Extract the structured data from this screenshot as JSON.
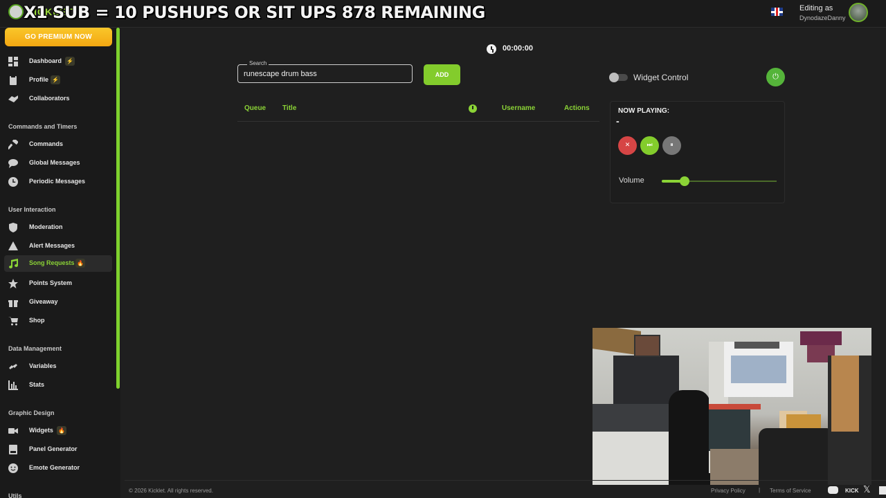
{
  "header": {
    "logo_text": "KICKLET",
    "stream_overlay": "X1 SUB = 10 PUSHUPS OR SIT UPS 878 REMAINING",
    "editing_label": "Editing as",
    "editing_user": "DynodazeDanny",
    "language_flag": "uk-flag-icon"
  },
  "sidebar": {
    "premium_button": "GO PREMIUM NOW",
    "items": [
      {
        "label": "Dashboard",
        "icon": "dashboard-icon",
        "badge": "⚡"
      },
      {
        "label": "Profile",
        "icon": "profile-icon",
        "badge": "⚡"
      },
      {
        "label": "Collaborators",
        "icon": "handshake-icon",
        "badge": ""
      }
    ],
    "sections": [
      {
        "title": "Commands and Timers",
        "items": [
          {
            "label": "Commands",
            "icon": "hammer-icon",
            "badge": ""
          },
          {
            "label": "Global Messages",
            "icon": "chat-icon",
            "badge": ""
          },
          {
            "label": "Periodic Messages",
            "icon": "clock-icon",
            "badge": ""
          }
        ]
      },
      {
        "title": "User Interaction",
        "items": [
          {
            "label": "Moderation",
            "icon": "shield-icon",
            "badge": ""
          },
          {
            "label": "Alert Messages",
            "icon": "warning-icon",
            "badge": ""
          },
          {
            "label": "Song Requests",
            "icon": "music-icon",
            "badge": "🔥",
            "active": true
          },
          {
            "label": "Points System",
            "icon": "star-icon",
            "badge": ""
          },
          {
            "label": "Giveaway",
            "icon": "gift-icon",
            "badge": ""
          },
          {
            "label": "Shop",
            "icon": "cart-icon",
            "badge": ""
          }
        ]
      },
      {
        "title": "Data Management",
        "items": [
          {
            "label": "Variables",
            "icon": "link-icon",
            "badge": ""
          },
          {
            "label": "Stats",
            "icon": "bar-chart-icon",
            "badge": ""
          }
        ]
      },
      {
        "title": "Graphic Design",
        "items": [
          {
            "label": "Widgets",
            "icon": "camera-icon",
            "badge": "🔥"
          },
          {
            "label": "Panel Generator",
            "icon": "panel-icon",
            "badge": ""
          },
          {
            "label": "Emote Generator",
            "icon": "smile-icon",
            "badge": ""
          }
        ]
      },
      {
        "title": "Utils",
        "items": []
      }
    ]
  },
  "main": {
    "timer": "00:00:00",
    "search": {
      "label": "Search",
      "value": "runescape drum bass"
    },
    "add_button": "ADD",
    "table_headers": {
      "queue": "Queue",
      "title": "Title",
      "username": "Username",
      "actions": "Actions"
    },
    "widget_control": {
      "label": "Widget Control",
      "enabled": false
    },
    "now_playing": {
      "title": "NOW PLAYING:",
      "song": "-",
      "volume_label": "Volume",
      "volume": 0.2
    }
  },
  "footer": {
    "copyright": "© 2026 Kicklet. All rights reserved.",
    "privacy": "Privacy Policy",
    "separator": "|",
    "terms": "Terms of Service",
    "kick": "KICK"
  },
  "colors": {
    "accent": "#8bd336",
    "premium": "#f7b31f",
    "stop": "#d64545",
    "background": "#1f1f1f"
  }
}
